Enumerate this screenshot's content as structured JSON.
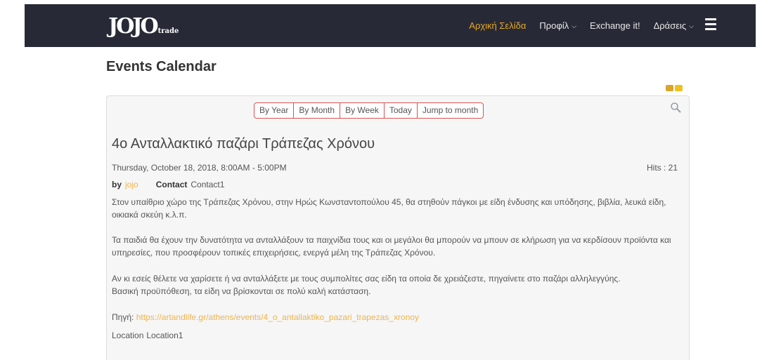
{
  "navbar": {
    "logo_main": "JOJO",
    "logo_sub": "trade",
    "items": [
      {
        "label": "Αρχική Σελίδα",
        "active": true,
        "dropdown": false
      },
      {
        "label": "Προφίλ",
        "active": false,
        "dropdown": true
      },
      {
        "label": "Exchange it!",
        "active": false,
        "dropdown": false
      },
      {
        "label": "Δράσεις",
        "active": false,
        "dropdown": true
      }
    ],
    "menu_icon": "hamburger-icon",
    "colors": {
      "background": "#272a36",
      "accent": "#e9a723"
    }
  },
  "page": {
    "title": "Events Calendar",
    "tool_icons": [
      "print-icon",
      "email-icon"
    ]
  },
  "calendar_nav": {
    "buttons": [
      "By Year",
      "By Month",
      "By Week",
      "Today",
      "Jump to month"
    ],
    "search_icon": "search-icon",
    "border_color": "#d9534f"
  },
  "event": {
    "title": "4ο Ανταλλακτικό παζάρι Τράπεζας Χρόνου",
    "datetime": "Thursday, October 18, 2018, 8:00AM - 5:00PM",
    "hits": "Hits : 21",
    "by_label": "by",
    "author": "jojo",
    "contact_label": "Contact",
    "contact_value": "Contact1",
    "paragraphs": [
      "Στον υπαίθριο χώρο της Τράπεζας Χρόνου, στην Ηρώς Κωνσταντοπούλου 45, θα στηθούν πάγκοι με είδη ένδυσης και υπόδησης, βιβλία, λευκά είδη, οικιακά σκεύη κ.λ.π.",
      "Τα παιδιά θα έχουν την δυνατότητα να ανταλλάξουν τα παιχνίδια τους και οι μεγάλοι θα μπορούν να μπουν σε κλήρωση για να κερδίσουν προϊόντα και υπηρεσίες, που προσφέρουν τοπικές επιχειρήσεις, ενεργά μέλη της Τράπεζας Χρόνου.",
      "Αν κι εσείς θέλετε να χαρίσετε ή να ανταλλάξετε με τους συμπολίτες σας είδη τα οποία δε χρειάζεστε, πηγαίνετε στο παζάρι αλληλεγγύης.\nΒασική προϋπόθεση, τα είδη να βρίσκονται σε πολύ καλή κατάσταση."
    ],
    "source_label": "Πηγή:",
    "source_link": "https://artandlife.gr/athens/events/4_o_antallaktiko_pazari_trapezas_xronoy",
    "location_label": "Location",
    "location_value": "Location1"
  }
}
